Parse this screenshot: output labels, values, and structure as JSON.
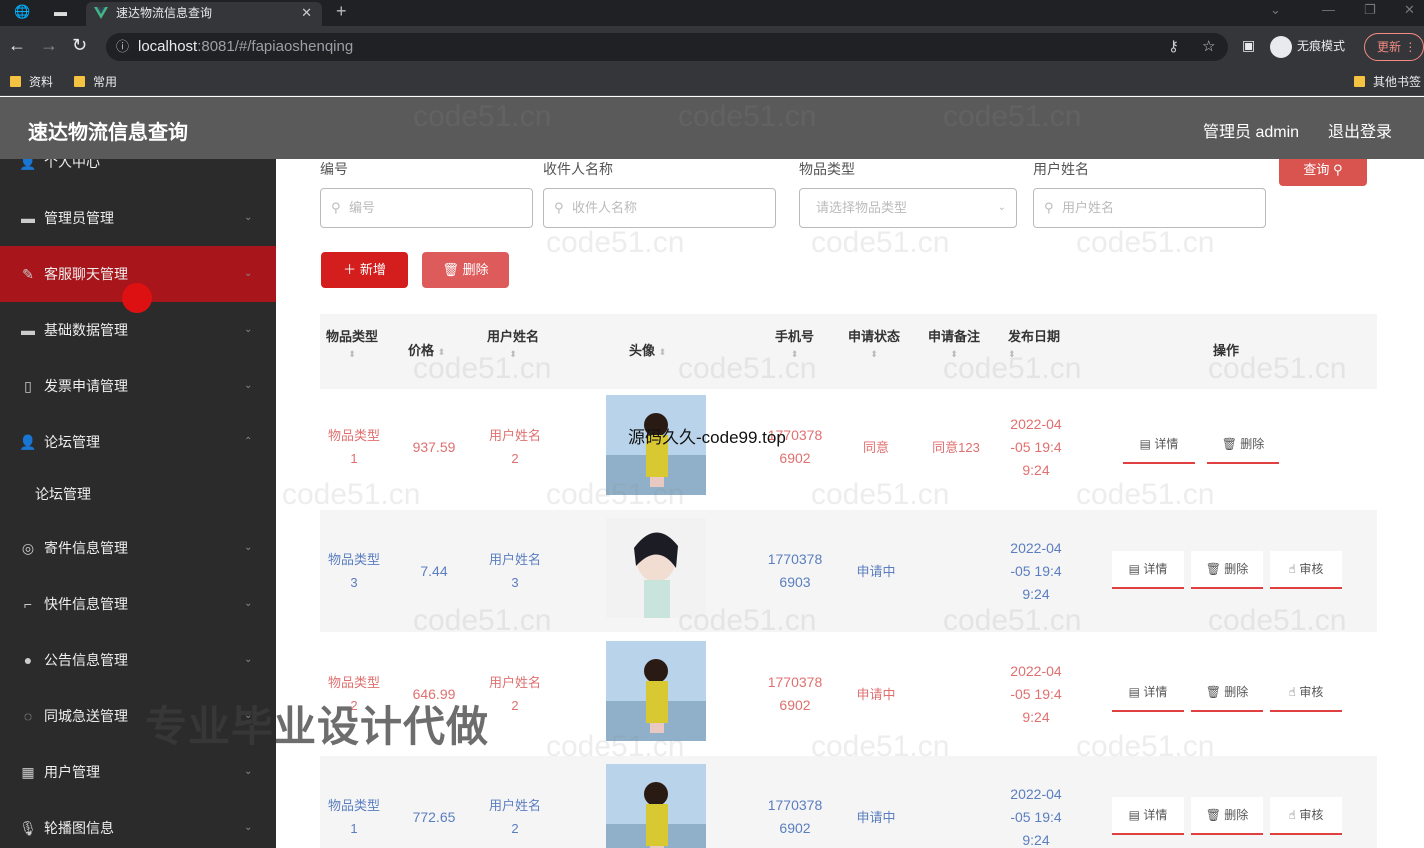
{
  "browser": {
    "tab_title": "速达物流信息查询",
    "url_host": "localhost",
    "url_path": ":8081/#/fapiaoshenqing",
    "incognito_label": "无痕模式",
    "update_label": "更新",
    "bookmarks": [
      "资料",
      "常用"
    ],
    "other_bookmarks": "其他书签"
  },
  "header": {
    "title": "速达物流信息查询",
    "admin": "管理员 admin",
    "logout": "退出登录"
  },
  "sidebar": {
    "items": [
      {
        "label": "个人中心",
        "icon": "user-icon"
      },
      {
        "label": "管理员管理",
        "icon": "admin-icon"
      },
      {
        "label": "客服聊天管理",
        "icon": "chat-icon"
      },
      {
        "label": "基础数据管理",
        "icon": "database-icon"
      },
      {
        "label": "发票申请管理",
        "icon": "invoice-icon"
      },
      {
        "label": "论坛管理",
        "icon": "forum-icon"
      },
      {
        "label": "论坛管理",
        "icon": ""
      },
      {
        "label": "寄件信息管理",
        "icon": "send-icon"
      },
      {
        "label": "快件信息管理",
        "icon": "package-icon"
      },
      {
        "label": "公告信息管理",
        "icon": "bulb-icon"
      },
      {
        "label": "同城急送管理",
        "icon": "delivery-icon"
      },
      {
        "label": "用户管理",
        "icon": "users-icon"
      },
      {
        "label": "轮播图信息",
        "icon": "image-icon"
      }
    ]
  },
  "search": {
    "f1_label": "编号",
    "f1_placeholder": "编号",
    "f2_label": "收件人名称",
    "f2_placeholder": "收件人名称",
    "f3_label": "物品类型",
    "f3_placeholder": "请选择物品类型",
    "f4_label": "用户姓名",
    "f4_placeholder": "用户姓名",
    "query_label": "查询"
  },
  "actions": {
    "add_label": "新增",
    "delete_label": "删除"
  },
  "table": {
    "headers": [
      "物品类型",
      "价格",
      "用户姓名",
      "头像",
      "手机号",
      "申请状态",
      "申请备注",
      "发布日期",
      "操作"
    ],
    "rows": [
      {
        "type": "物品类型\n1",
        "price": "937.59",
        "user": "用户姓名\n2",
        "phone": "1770378\n6902",
        "status": "同意",
        "note": "同意123",
        "date": "2022-04\n-05 19:4\n9:24",
        "ops": [
          "详情",
          "删除"
        ]
      },
      {
        "type": "物品类型\n3",
        "price": "7.44",
        "user": "用户姓名\n3",
        "phone": "1770378\n6903",
        "status": "申请中",
        "note": "",
        "date": "2022-04\n-05 19:4\n9:24",
        "ops": [
          "详情",
          "删除",
          "审核"
        ]
      },
      {
        "type": "物品类型\n2",
        "price": "646.99",
        "user": "用户姓名\n2",
        "phone": "1770378\n6902",
        "status": "申请中",
        "note": "",
        "date": "2022-04\n-05 19:4\n9:24",
        "ops": [
          "详情",
          "删除",
          "审核"
        ]
      },
      {
        "type": "物品类型\n1",
        "price": "772.65",
        "user": "用户姓名\n2",
        "phone": "1770378\n6902",
        "status": "申请中",
        "note": "",
        "date": "2022-04\n-05 19:4\n9:24",
        "ops": [
          "详情",
          "删除",
          "审核"
        ]
      }
    ]
  },
  "overlays": {
    "source_text": "源码久久-code99.top",
    "promo_text": "专业毕业设计代做",
    "watermark": "code51.cn"
  },
  "colors": {
    "accent": "#d41e1e",
    "sidebar_bg": "#2b2b2b",
    "header_bg": "#5a5a5a",
    "link_red": "#e07070",
    "link_blue": "#5b7ec0"
  }
}
